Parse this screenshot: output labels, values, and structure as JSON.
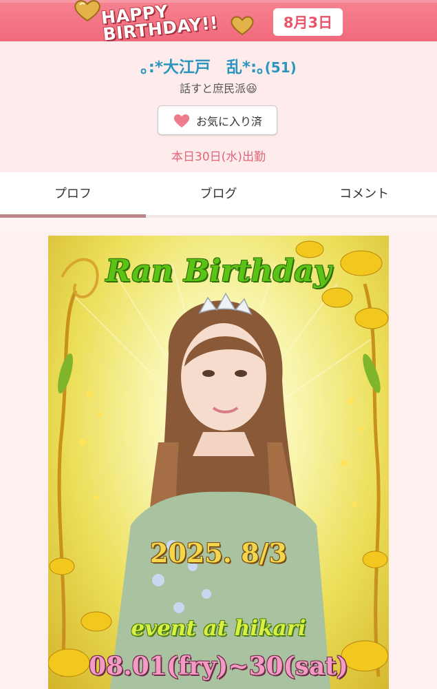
{
  "banner": {
    "title": "HAPPY\nBIRTHDAY!!",
    "date_badge": "8月3日"
  },
  "profile": {
    "name": "｡:*大江戸　乱*:｡",
    "age": "(51)",
    "catchphrase": "話すと庶民派😆",
    "favorite_button_label": "お気に入り済",
    "work_status": "本日30日(水)出勤"
  },
  "tabs": [
    {
      "label": "プロフ",
      "active": true
    },
    {
      "label": "ブログ",
      "active": false
    },
    {
      "label": "コメント",
      "active": false
    }
  ],
  "flyer": {
    "title": "Ran Birthday",
    "date": "2025. 8/3",
    "event": "event at hikari",
    "period": "08.01(fry)~30(sat)"
  },
  "colors": {
    "banner": "#f06a7c",
    "accent_pink": "#e2657a",
    "name_blue": "#2a96c0",
    "tab_underline": "#b98585"
  },
  "icons": {
    "favorite": "heart-icon",
    "balloons": "heart-balloon-icon"
  }
}
